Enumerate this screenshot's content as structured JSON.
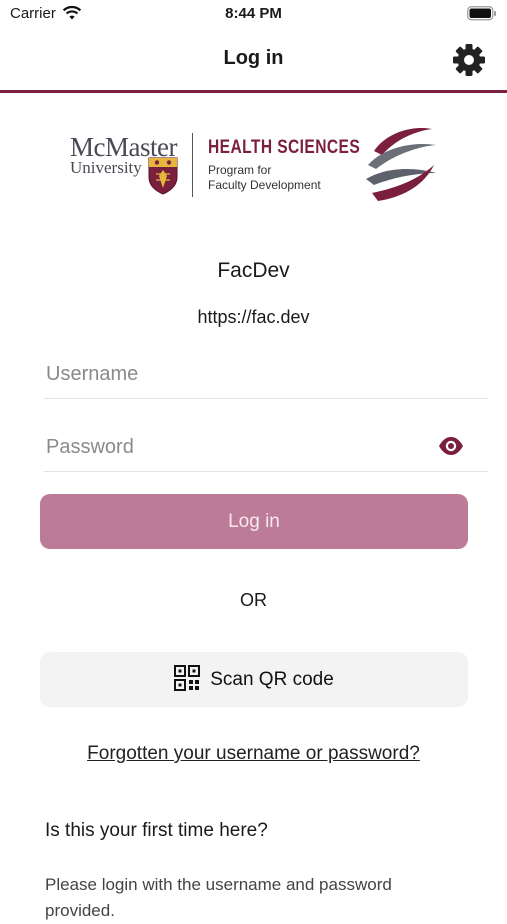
{
  "status_bar": {
    "carrier": "Carrier",
    "time": "8:44 PM"
  },
  "navbar": {
    "title": "Log in",
    "settings_icon": "gear-icon"
  },
  "logo": {
    "university_line1": "McMaster",
    "university_line2": "University",
    "faculty": "HEALTH SCIENCES",
    "program_line1": "Program for",
    "program_line2": "Faculty Development",
    "colors": {
      "maroon": "#7a1f3d",
      "gray": "#4a4a55"
    }
  },
  "site": {
    "name": "FacDev",
    "url": "https://fac.dev"
  },
  "form": {
    "username_placeholder": "Username",
    "password_placeholder": "Password",
    "show_password_icon": "eye-icon"
  },
  "buttons": {
    "login": "Log in",
    "or": "OR",
    "scan_qr": "Scan QR code"
  },
  "links": {
    "forgot": "Forgotten your username or password?"
  },
  "first_time": {
    "heading": "Is this your first time here?",
    "body": "Please login with the username and password provided."
  },
  "colors": {
    "accent": "#7a1f3d",
    "login_button": "#bc7c97",
    "qr_button": "#f3f3f3"
  }
}
